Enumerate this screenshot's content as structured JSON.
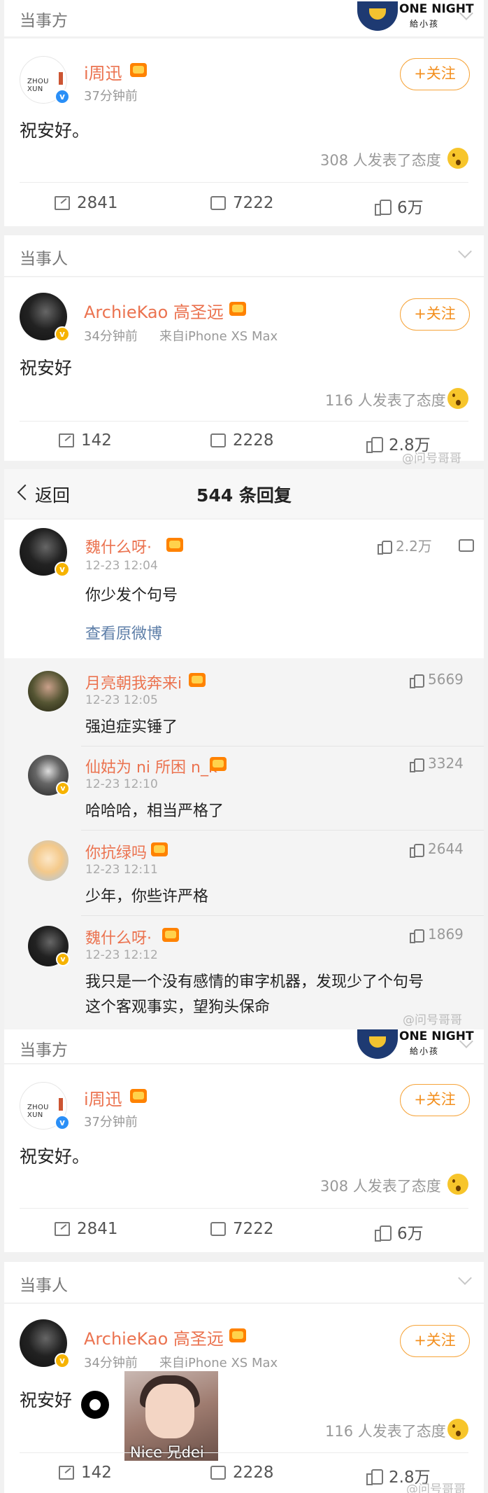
{
  "section1": {
    "label": "当事方",
    "ad": {
      "title": "ONE NIGHT",
      "subtitle": "給小孩"
    },
    "post": {
      "name": "i周迅",
      "avatar_text": "ZHOU XUN",
      "time": "37分钟前",
      "follow": "+关注",
      "content": "祝安好。",
      "reactions": "308 人发表了态度",
      "share": "2841",
      "comment": "7222",
      "like": "6万"
    }
  },
  "section2": {
    "label": "当事人",
    "post": {
      "name": "ArchieKao 高圣远",
      "time": "34分钟前",
      "source": "来自iPhone XS Max",
      "follow": "+关注",
      "content": "祝安好",
      "reactions": "116 人发表了态度",
      "share": "142",
      "comment": "2228",
      "like": "2.8万"
    },
    "watermark": "@问号哥哥"
  },
  "nav": {
    "back": "返回",
    "title": "544 条回复"
  },
  "main_comment": {
    "name": "魏什么呀·",
    "time": "12-23 12:04",
    "likes": "2.2万",
    "text": "你少发个句号",
    "link": "查看原微博"
  },
  "replies": [
    {
      "name": "月亮朝我奔来i",
      "time": "12-23 12:05",
      "likes": "5669",
      "text": "强迫症实锤了"
    },
    {
      "name": "仙姑为 ni 所困 n_k",
      "time": "12-23 12:10",
      "likes": "3324",
      "text": "哈哈哈，相当严格了"
    },
    {
      "name": "你抗绿吗",
      "time": "12-23 12:11",
      "likes": "2644",
      "text": "少年，你些许严格"
    },
    {
      "name": "魏什么呀·",
      "time": "12-23 12:12",
      "likes": "1869",
      "text": "我只是一个没有感情的审字机器，发现少了个句号",
      "text2": "这个客观事实，望狗头保命"
    }
  ],
  "reply_watermark": "@问号哥哥",
  "section3": {
    "label": "当事方",
    "ad": {
      "title": "ONE NIGHT",
      "subtitle": "給小孩"
    },
    "post": {
      "name": "i周迅",
      "avatar_text": "ZHOU XUN",
      "time": "37分钟前",
      "follow": "+关注",
      "content": "祝安好。",
      "reactions": "308 人发表了态度",
      "share": "2841",
      "comment": "7222",
      "like": "6万"
    }
  },
  "section4": {
    "label": "当事人",
    "post": {
      "name": "ArchieKao 高圣远",
      "time": "34分钟前",
      "source": "来自iPhone XS Max",
      "follow": "+关注",
      "content": "祝安好",
      "reactions": "116 人发表了态度",
      "share": "142",
      "comment": "2228",
      "like": "2.8万"
    },
    "sticker_text": "Nice 兄dei",
    "watermark": "@问号哥哥"
  }
}
